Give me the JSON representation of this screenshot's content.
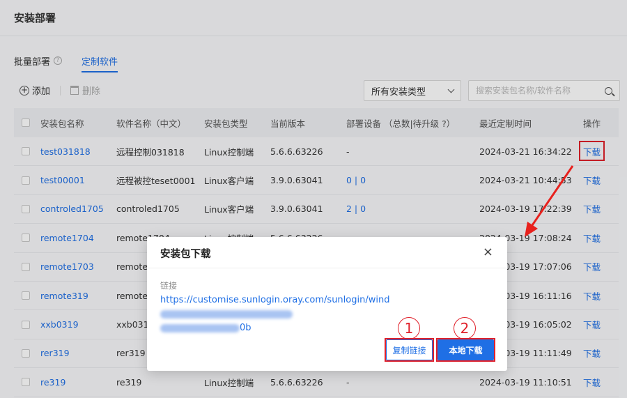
{
  "page": {
    "title": "安装部署"
  },
  "tabs": [
    {
      "label": "批量部署",
      "help": "?"
    },
    {
      "label": "定制软件"
    }
  ],
  "toolbar": {
    "add_label": "添加",
    "delete_label": "删除"
  },
  "filter": {
    "type_select_value": "所有安装类型",
    "search_placeholder": "搜索安装包名称/软件名称"
  },
  "table": {
    "headers": [
      "安装包名称",
      "软件名称（中文）",
      "安装包类型",
      "当前版本",
      "部署设备 （总数|待升级 ?）",
      "最近定制时间",
      "操作"
    ],
    "rows": [
      {
        "pkg": "test031818",
        "name": "远程控制031818",
        "type": "Linux控制端",
        "version": "5.6.6.63226",
        "devices": "-",
        "time": "2024-03-21 16:34:22",
        "op": "下载"
      },
      {
        "pkg": "test00001",
        "name": "远程被控teset0001",
        "type": "Linux客户端",
        "version": "3.9.0.63041",
        "devices": "0 | 0",
        "time": "2024-03-21 10:44:53",
        "op": "下载"
      },
      {
        "pkg": "controled1705",
        "name": "controled1705",
        "type": "Linux客户端",
        "version": "3.9.0.63041",
        "devices": "2 | 0",
        "time": "2024-03-19 17:22:39",
        "op": "下载"
      },
      {
        "pkg": "remote1704",
        "name": "remote1704",
        "type": "Linux控制端",
        "version": "5.6.6.63226",
        "devices": "",
        "time": "2024-03-19 17:08:24",
        "op": "下载"
      },
      {
        "pkg": "remote1703",
        "name": "remote",
        "type": "",
        "version": "",
        "devices": "",
        "time": "2024-03-19 17:07:06",
        "op": "下载"
      },
      {
        "pkg": "remote319",
        "name": "remote",
        "type": "",
        "version": "",
        "devices": "",
        "time": "2024-03-19 16:11:16",
        "op": "下载"
      },
      {
        "pkg": "xxb0319",
        "name": "xxb031",
        "type": "",
        "version": "",
        "devices": "",
        "time": "2024-03-19 16:05:02",
        "op": "下载"
      },
      {
        "pkg": "rer319",
        "name": "rer319",
        "type": "",
        "version": "",
        "devices": "",
        "time": "2024-03-19 11:11:49",
        "op": "下载"
      },
      {
        "pkg": "re319",
        "name": "re319",
        "type": "Linux控制端",
        "version": "5.6.6.63226",
        "devices": "-",
        "time": "2024-03-19 11:10:51",
        "op": "下载"
      }
    ]
  },
  "dialog": {
    "title": "安装包下载",
    "close": "×",
    "link_label": "链接",
    "link_visible": "https://customise.sunlogin.oray.com/sunlogin/wind",
    "link_tail": "0b",
    "copy_button": "复制链接",
    "local_download_button": "本地下载"
  },
  "annotations": {
    "step1": "1",
    "step2": "2",
    "highlight_color": "#e0202a"
  },
  "colors": {
    "accent": "#1f6fe5",
    "annotation": "#e0202a"
  }
}
